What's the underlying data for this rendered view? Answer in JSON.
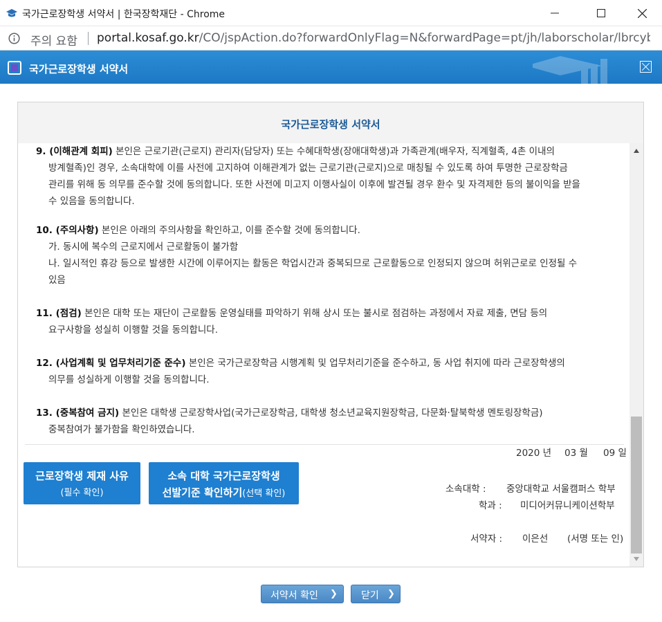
{
  "window": {
    "title": "국가근로장학생 서약서 | 한국장학재단 - Chrome"
  },
  "addressbar": {
    "warning": "주의 요함",
    "url_host": "portal.kosaf.go.kr",
    "url_path": "/CO/jspAction.do?forwardOnlyFlag=N&forwardPage=pt/jh/laborscholar/lbrcyber..."
  },
  "popup": {
    "title": "국가근로장학생 서약서"
  },
  "panel": {
    "title": "국가근로장학생 서약서"
  },
  "clauses": [
    {
      "num": "9. (이해관계 회피)",
      "lines": [
        " 본인은 근로기관(근로지) 관리자(담당자) 또는 수혜대학생(장애대학생)과 가족관계(배우자, 직계혈족, 4촌 이내의",
        "방계혈족)인 경우, 소속대학에 이를 사전에 고지하여 이해관계가 없는 근로기관(근로지)으로 매칭될 수 있도록 하여 투명한 근로장학금",
        "관리를 위해 동 의무를 준수할 것에 동의합니다. 또한 사전에 미고지 이행사실이 이후에 발견될 경우 환수 및 자격제한 등의 불이익을 받을",
        "수 있음을 동의합니다."
      ]
    },
    {
      "num": "10. (주의사항)",
      "lines": [
        " 본인은 아래의 주의사항을 확인하고, 이를 준수할 것에 동의합니다.",
        "가. 동시에 복수의 근로지에서 근로활동이 불가함",
        "나. 일시적인 휴강 등으로 발생한 시간에 이루어지는 활동은 학업시간과 중복되므로 근로활동으로 인정되지 않으며 허위근로로 인정될 수",
        "있음"
      ]
    },
    {
      "num": "11. (점검)",
      "lines": [
        " 본인은 대학 또는 재단이 근로활동 운영실태를 파악하기 위해 상시 또는 불시로 점검하는 과정에서 자료 제출, 면담 등의",
        "요구사항을 성실히 이행할 것을 동의합니다."
      ]
    },
    {
      "num": "12. (사업계획 및 업무처리기준 준수)",
      "lines": [
        " 본인은 국가근로장학금 시행계획 및 업무처리기준을 준수하고, 동 사업 취지에 따라 근로장학생의",
        "의무를 성실하게 이행할 것을 동의합니다."
      ]
    },
    {
      "num": "13. (중복참여 금지)",
      "lines": [
        " 본인은 대학생 근로장학사업(국가근로장학금, 대학생 청소년교육지원장학금, 다문화·탈북학생 멘토링장학금)",
        "중복참여가 불가함을 확인하였습니다."
      ]
    }
  ],
  "buttons": {
    "reason_line1": "근로장학생 제재 사유",
    "reason_line2": "(필수 확인)",
    "criteria_line1": "소속 대학 국가근로장학생",
    "criteria_line2": "선발기준 확인하기",
    "criteria_line2_small": "(선택 확인)",
    "confirm": "서약서 확인",
    "close": "닫기"
  },
  "signature": {
    "year": "2020 년",
    "month": "03 월",
    "day": "09 일",
    "univ_label": "소속대학 :",
    "univ_value": "중앙대학교 서울캠퍼스 학부",
    "dept_label": "학과 :",
    "dept_value": "미디어커뮤니케이션학부",
    "signer_label": "서약자 :",
    "signer_value": "이은선",
    "sign_hint": "(서명 또는 인)"
  },
  "colors": {
    "header_blue": "#1d78c4",
    "button_blue": "#1f7fd0",
    "title_blue": "#1b5a97"
  }
}
